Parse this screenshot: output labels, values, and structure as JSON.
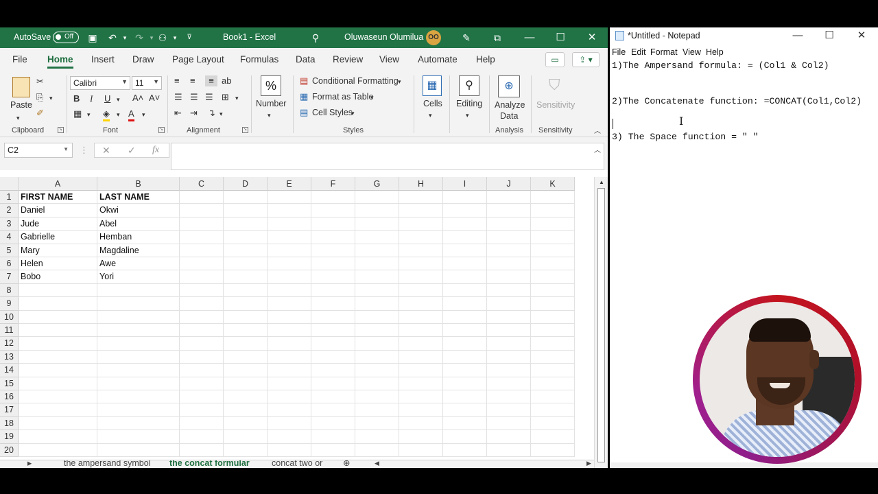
{
  "excel": {
    "autosave_label": "AutoSave",
    "autosave_state": "Off",
    "title": "Book1  -  Excel",
    "user_name": "Oluwaseun Olumilua",
    "user_initials": "OO",
    "menu": [
      "File",
      "Home",
      "Insert",
      "Draw",
      "Page Layout",
      "Formulas",
      "Data",
      "Review",
      "View",
      "Automate",
      "Help"
    ],
    "active_menu": "Home",
    "ribbon": {
      "paste_label": "Paste",
      "font_name": "Calibri",
      "font_size": "11",
      "number_label": "Number",
      "conditional_formatting": "Conditional Formatting",
      "format_as_table": "Format as Table",
      "cell_styles": "Cell Styles",
      "cells_label": "Cells",
      "editing_label": "Editing",
      "analyze_label": "Analyze",
      "analyze_label2": "Data",
      "sensitivity_label": "Sensitivity",
      "groups": {
        "clipboard": "Clipboard",
        "font": "Font",
        "alignment": "Alignment",
        "styles": "Styles",
        "analysis": "Analysis",
        "sensitivity": "Sensitivity"
      }
    },
    "name_box": "C2",
    "columns": [
      "A",
      "B",
      "C",
      "D",
      "E",
      "F",
      "G",
      "H",
      "I",
      "J",
      "K"
    ],
    "rows": [
      "1",
      "2",
      "3",
      "4",
      "5",
      "6",
      "7",
      "8",
      "9",
      "10",
      "11",
      "12",
      "13",
      "14",
      "15",
      "16",
      "17",
      "18",
      "19",
      "20"
    ],
    "cells": {
      "header": [
        "FIRST NAME",
        "LAST NAME"
      ],
      "data": [
        [
          "Daniel",
          "Okwi"
        ],
        [
          "Jude",
          "Abel"
        ],
        [
          "Gabrielle",
          "Hemban"
        ],
        [
          "Mary",
          "Magdaline"
        ],
        [
          "Helen",
          "Awe"
        ],
        [
          "Bobo",
          "Yori"
        ]
      ]
    },
    "sheet_tabs": [
      "the ampersand symbol",
      "the concat formular",
      "concat two or"
    ],
    "active_sheet": "the concat formular"
  },
  "notepad": {
    "title": "*Untitled - Notepad",
    "menu": [
      "File",
      "Edit",
      "Format",
      "View",
      "Help"
    ],
    "lines": [
      "1)The Ampersand formula: = (Col1 & Col2)",
      "",
      "",
      "2)The Concatenate function: =CONCAT(Col1,Col2)",
      "",
      "",
      "3) The Space function = \" \""
    ]
  }
}
